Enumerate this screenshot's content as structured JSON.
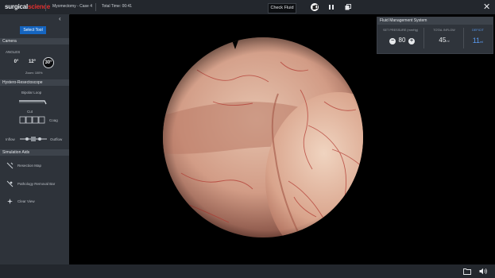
{
  "brand": {
    "part1": "surgical",
    "part2": "science"
  },
  "topbar": {
    "case": "Myomectomy - Case 4",
    "time": "Total Time: 00:41",
    "check_fluid": "Check Fluid"
  },
  "sidebar": {
    "select_tool": "Select Tool",
    "camera": {
      "section": "Camera",
      "angles_label": "ANGLES",
      "angles": [
        "0°",
        "12°",
        "30°"
      ],
      "active_angle": "30°",
      "zoom": "Zoom: 100%"
    },
    "hystero": {
      "section": "Hystero-Resectoscope",
      "tool_name": "Bipolar Loop",
      "cut_label": "Cut",
      "coag_label": "Coag",
      "inflow_label": "Inflow",
      "outflow_label": "Outflow"
    },
    "aids": {
      "section": "Simulation Aids",
      "items": [
        "Resection Map",
        "Pathology Removal Bar",
        "Clear View"
      ]
    }
  },
  "fluid": {
    "title": "Fluid Management System",
    "set_pressure_label": "SET PRESSURE (mmHg)",
    "set_pressure": "80",
    "total_inflow_label": "TOTAL INFLOW",
    "total_inflow": "45",
    "total_inflow_unit": "ml",
    "deficit_label": "DEFICIT",
    "deficit": "11",
    "deficit_unit": "ml"
  },
  "colors": {
    "accent": "#1565c0",
    "brand_red": "#e0302f",
    "deficit": "#5a9bf0"
  },
  "icons": [
    "panel-toggle-icon",
    "pause-icon",
    "window-icon",
    "close-icon",
    "folder-icon",
    "speaker-icon"
  ]
}
